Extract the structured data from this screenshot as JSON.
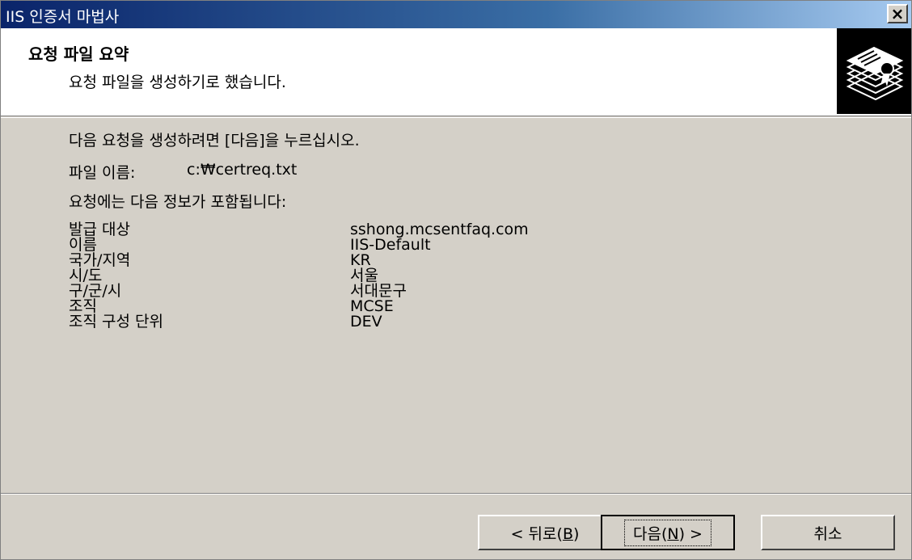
{
  "window": {
    "title": "IIS 인증서 마법사",
    "close_label": "×"
  },
  "header": {
    "title": "요청 파일 요약",
    "subtitle": "요청 파일을 생성하기로 했습니다."
  },
  "body": {
    "instruction": "다음 요청을 생성하려면 [다음]을 누르십시오.",
    "file_name_label": "파일 이름:",
    "file_name_value": "c:₩certreq.txt",
    "info_intro": "요청에는 다음 정보가 포함됩니다:",
    "info": [
      {
        "label": "발급 대상",
        "value": "sshong.mcsentfaq.com"
      },
      {
        "label": "이름",
        "value": "IIS-Default"
      },
      {
        "label": "국가/지역",
        "value": "KR"
      },
      {
        "label": "시/도",
        "value": "서울"
      },
      {
        "label": "구/군/시",
        "value": "서대문구"
      },
      {
        "label": "조직",
        "value": "MCSE"
      },
      {
        "label": "조직 구성 단위",
        "value": "DEV"
      }
    ]
  },
  "buttons": {
    "back_prefix": "< 뒤로(",
    "back_key": "B",
    "back_suffix": ")",
    "next_prefix": "다음(",
    "next_key": "N",
    "next_suffix": ") >",
    "cancel": "취소"
  }
}
